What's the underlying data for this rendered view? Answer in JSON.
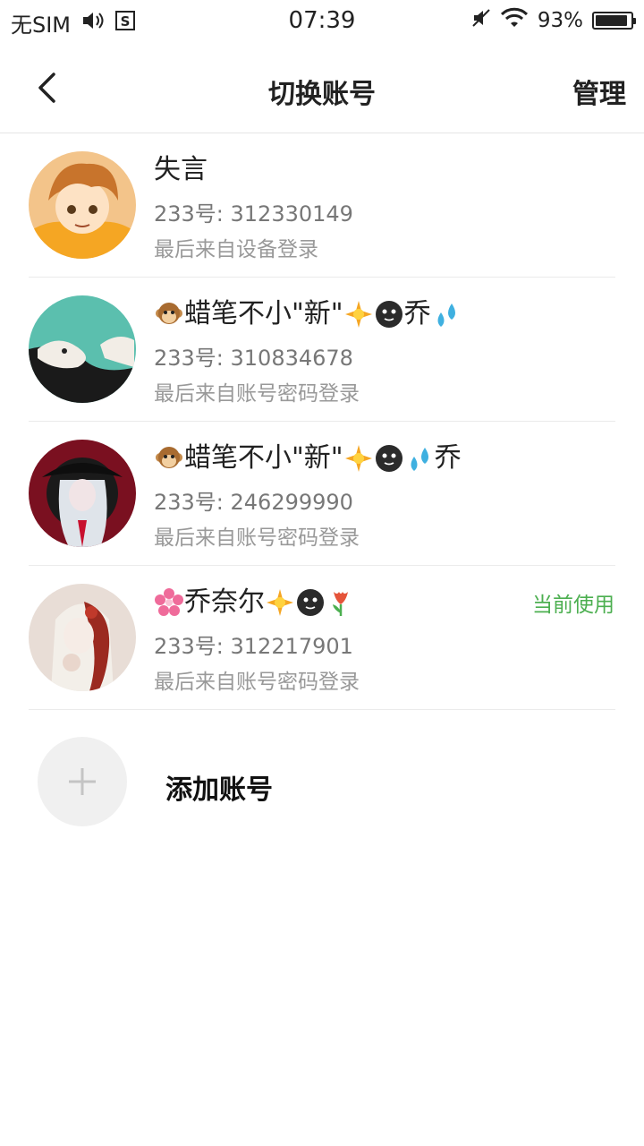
{
  "status_bar": {
    "carrier": "无SIM",
    "time": "07:39",
    "battery_percent_text": "93%",
    "battery_level": 0.93
  },
  "nav": {
    "title": "切换账号",
    "manage_label": "管理"
  },
  "accounts": [
    {
      "name": "失言",
      "uid": "233号: 312330149",
      "login": "最后来自设备登录",
      "current": ""
    },
    {
      "name_parts": [
        "蜡笔不小\"新\"",
        "乔"
      ],
      "uid": "233号: 310834678",
      "login": "最后来自账号密码登录",
      "current": ""
    },
    {
      "name_parts": [
        "蜡笔不小\"新\"",
        "乔"
      ],
      "uid": "233号: 246299990",
      "login": "最后来自账号密码登录",
      "current": ""
    },
    {
      "name_parts": [
        "乔奈尔"
      ],
      "uid": "233号: 312217901",
      "login": "最后来自账号密码登录",
      "current": "当前使用"
    }
  ],
  "add_account_label": "添加账号",
  "colors": {
    "current_badge": "#4caf50",
    "divider": "#ebebeb",
    "secondary_text": "#777777"
  }
}
